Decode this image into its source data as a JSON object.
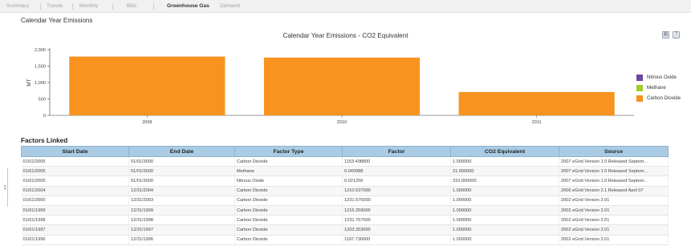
{
  "tabs": [
    {
      "label": "Summary",
      "active": false
    },
    {
      "label": "Trends",
      "active": false
    },
    {
      "label": "Monthly",
      "active": false
    },
    {
      "label": "Bills",
      "active": false
    },
    {
      "label": "Greenhouse Gas",
      "active": true
    },
    {
      "label": "Demand",
      "active": false
    }
  ],
  "section_title": "Calendar Year Emissions",
  "chart_tools": [
    {
      "icon": "print-icon",
      "glyph": "▤"
    },
    {
      "icon": "help-icon",
      "glyph": "?"
    }
  ],
  "chart_data": {
    "type": "bar",
    "title": "Calendar Year Emissions - CO2 Equivalent",
    "xlabel": "",
    "ylabel": "MT",
    "categories": [
      "2009",
      "2010",
      "2011"
    ],
    "series": [
      {
        "name": "Nitrous Oxide",
        "color": "#6a4a9c",
        "values": [
          0,
          0,
          0
        ]
      },
      {
        "name": "Methane",
        "color": "#9fcb2e",
        "values": [
          0,
          0,
          0
        ]
      },
      {
        "name": "Carbon Dioxide",
        "color": "#f7931e",
        "values": [
          1790,
          1760,
          710
        ]
      }
    ],
    "ylim": [
      0,
      2000
    ],
    "yticks": [
      "0",
      "500",
      "1,000",
      "1,500",
      "2,000"
    ],
    "ytick_values": [
      0,
      500,
      1000,
      1500,
      2000
    ],
    "grid": false,
    "legend": "right"
  },
  "factors_title": "Factors Linked",
  "table": {
    "columns": [
      "Start Date",
      "End Date",
      "Factor Type",
      "Factor",
      "CO2 Equivalent",
      "Source"
    ],
    "rows": [
      [
        "01/01/2005",
        "01/01/3000",
        "Carbon Dioxide",
        "1153.498800",
        "1.000000",
        "2007 eGrid Version 1.0 Released Septem..."
      ],
      [
        "01/01/2005",
        "01/01/3000",
        "Methane",
        "0.040988",
        "21.000000",
        "2007 eGrid Version 1.0 Released Septem..."
      ],
      [
        "01/01/2005",
        "01/01/3000",
        "Nitrous Oxide",
        "0.021256",
        "310.000000",
        "2007 eGrid Version 1.0 Released Septem..."
      ],
      [
        "01/01/2004",
        "12/31/2004",
        "Carbon Dioxide",
        "1210.537000",
        "1.000000",
        "2006 eGrid Version 2.1 Released April 07"
      ],
      [
        "01/01/2000",
        "12/31/2003",
        "Carbon Dioxide",
        "1231.575000",
        "1.000000",
        "2002 eGrid Version 2.01"
      ],
      [
        "01/01/1999",
        "12/31/1999",
        "Carbon Dioxide",
        "1216.259000",
        "1.000000",
        "2002 eGrid Version 2.01"
      ],
      [
        "01/01/1998",
        "12/31/1998",
        "Carbon Dioxide",
        "1231.757000",
        "1.000000",
        "2002 eGrid Version 2.01"
      ],
      [
        "01/01/1997",
        "12/31/1997",
        "Carbon Dioxide",
        "1203.353000",
        "1.000000",
        "2002 eGrid Version 2.01"
      ],
      [
        "01/01/1996",
        "12/31/1996",
        "Carbon Dioxide",
        "1197.730000",
        "1.000000",
        "2002 eGrid Version 2.01"
      ]
    ]
  }
}
